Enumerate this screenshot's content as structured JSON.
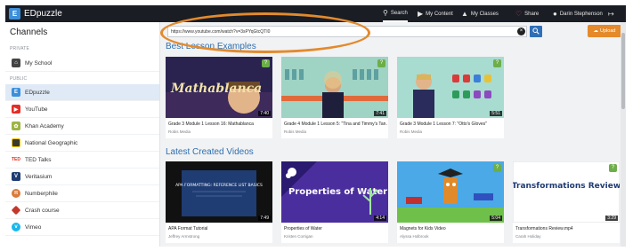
{
  "app": {
    "name": "EDpuzzle"
  },
  "topnav": {
    "search": "Search",
    "my_content": "My Content",
    "my_classes": "My Classes",
    "share": "Share",
    "user": "Darin Stephenson"
  },
  "sidebar": {
    "title": "Channels",
    "private_label": "PRIVATE",
    "public_label": "PUBLIC",
    "private_items": [
      {
        "label": "My School"
      }
    ],
    "public_items": [
      {
        "label": "EDpuzzle"
      },
      {
        "label": "YouTube"
      },
      {
        "label": "Khan Academy"
      },
      {
        "label": "National Geographic"
      },
      {
        "label": "TED Talks"
      },
      {
        "label": "Veritasium"
      },
      {
        "label": "Numberphile"
      },
      {
        "label": "Crash course"
      },
      {
        "label": "Vimeo"
      }
    ]
  },
  "search": {
    "value": "https://www.youtube.com/watch?v=3sPYqGtcQTI0",
    "upload_label": "Upload"
  },
  "best_lessons": {
    "title": "Best Lesson Examples",
    "items": [
      {
        "title": "Grade 3 Module 1 Lesson 16: Mathablanca",
        "author": "Robis Media",
        "duration": "7:40",
        "thumb_text": "Mathablanca"
      },
      {
        "title": "Grade 4 Module 1 Lesson 5: \"Tina and Timmy's Tan...",
        "author": "Robis Media",
        "duration": "7:41"
      },
      {
        "title": "Grade 3 Module 1 Lesson 7: \"Otto's Gloves\"",
        "author": "Robis Media",
        "duration": "5:51"
      }
    ]
  },
  "latest_videos": {
    "title": "Latest Created Videos",
    "items": [
      {
        "title": "APA Format Tutorial",
        "author": "Jeffrey Armstrong",
        "duration": "7:49",
        "thumb_text": "APA FORMATTING: REFERENCE LIST BASICS"
      },
      {
        "title": "Properties of Water",
        "author": "Kristen Corrigan",
        "duration": "4:14",
        "thumb_text": "Properties of Water"
      },
      {
        "title": "Magnets for Kids Video",
        "author": "Alyssa Holbrook",
        "duration": "5:04"
      },
      {
        "title": "Transformations Review.mp4",
        "author": "Carah Holiday",
        "duration": "3:29",
        "thumb_text": "Transformations Review"
      }
    ]
  },
  "colors": {
    "accent": "#2e6fae",
    "upload": "#e48a2a",
    "highlight": "#e38a2d",
    "check": "#6cae48"
  }
}
